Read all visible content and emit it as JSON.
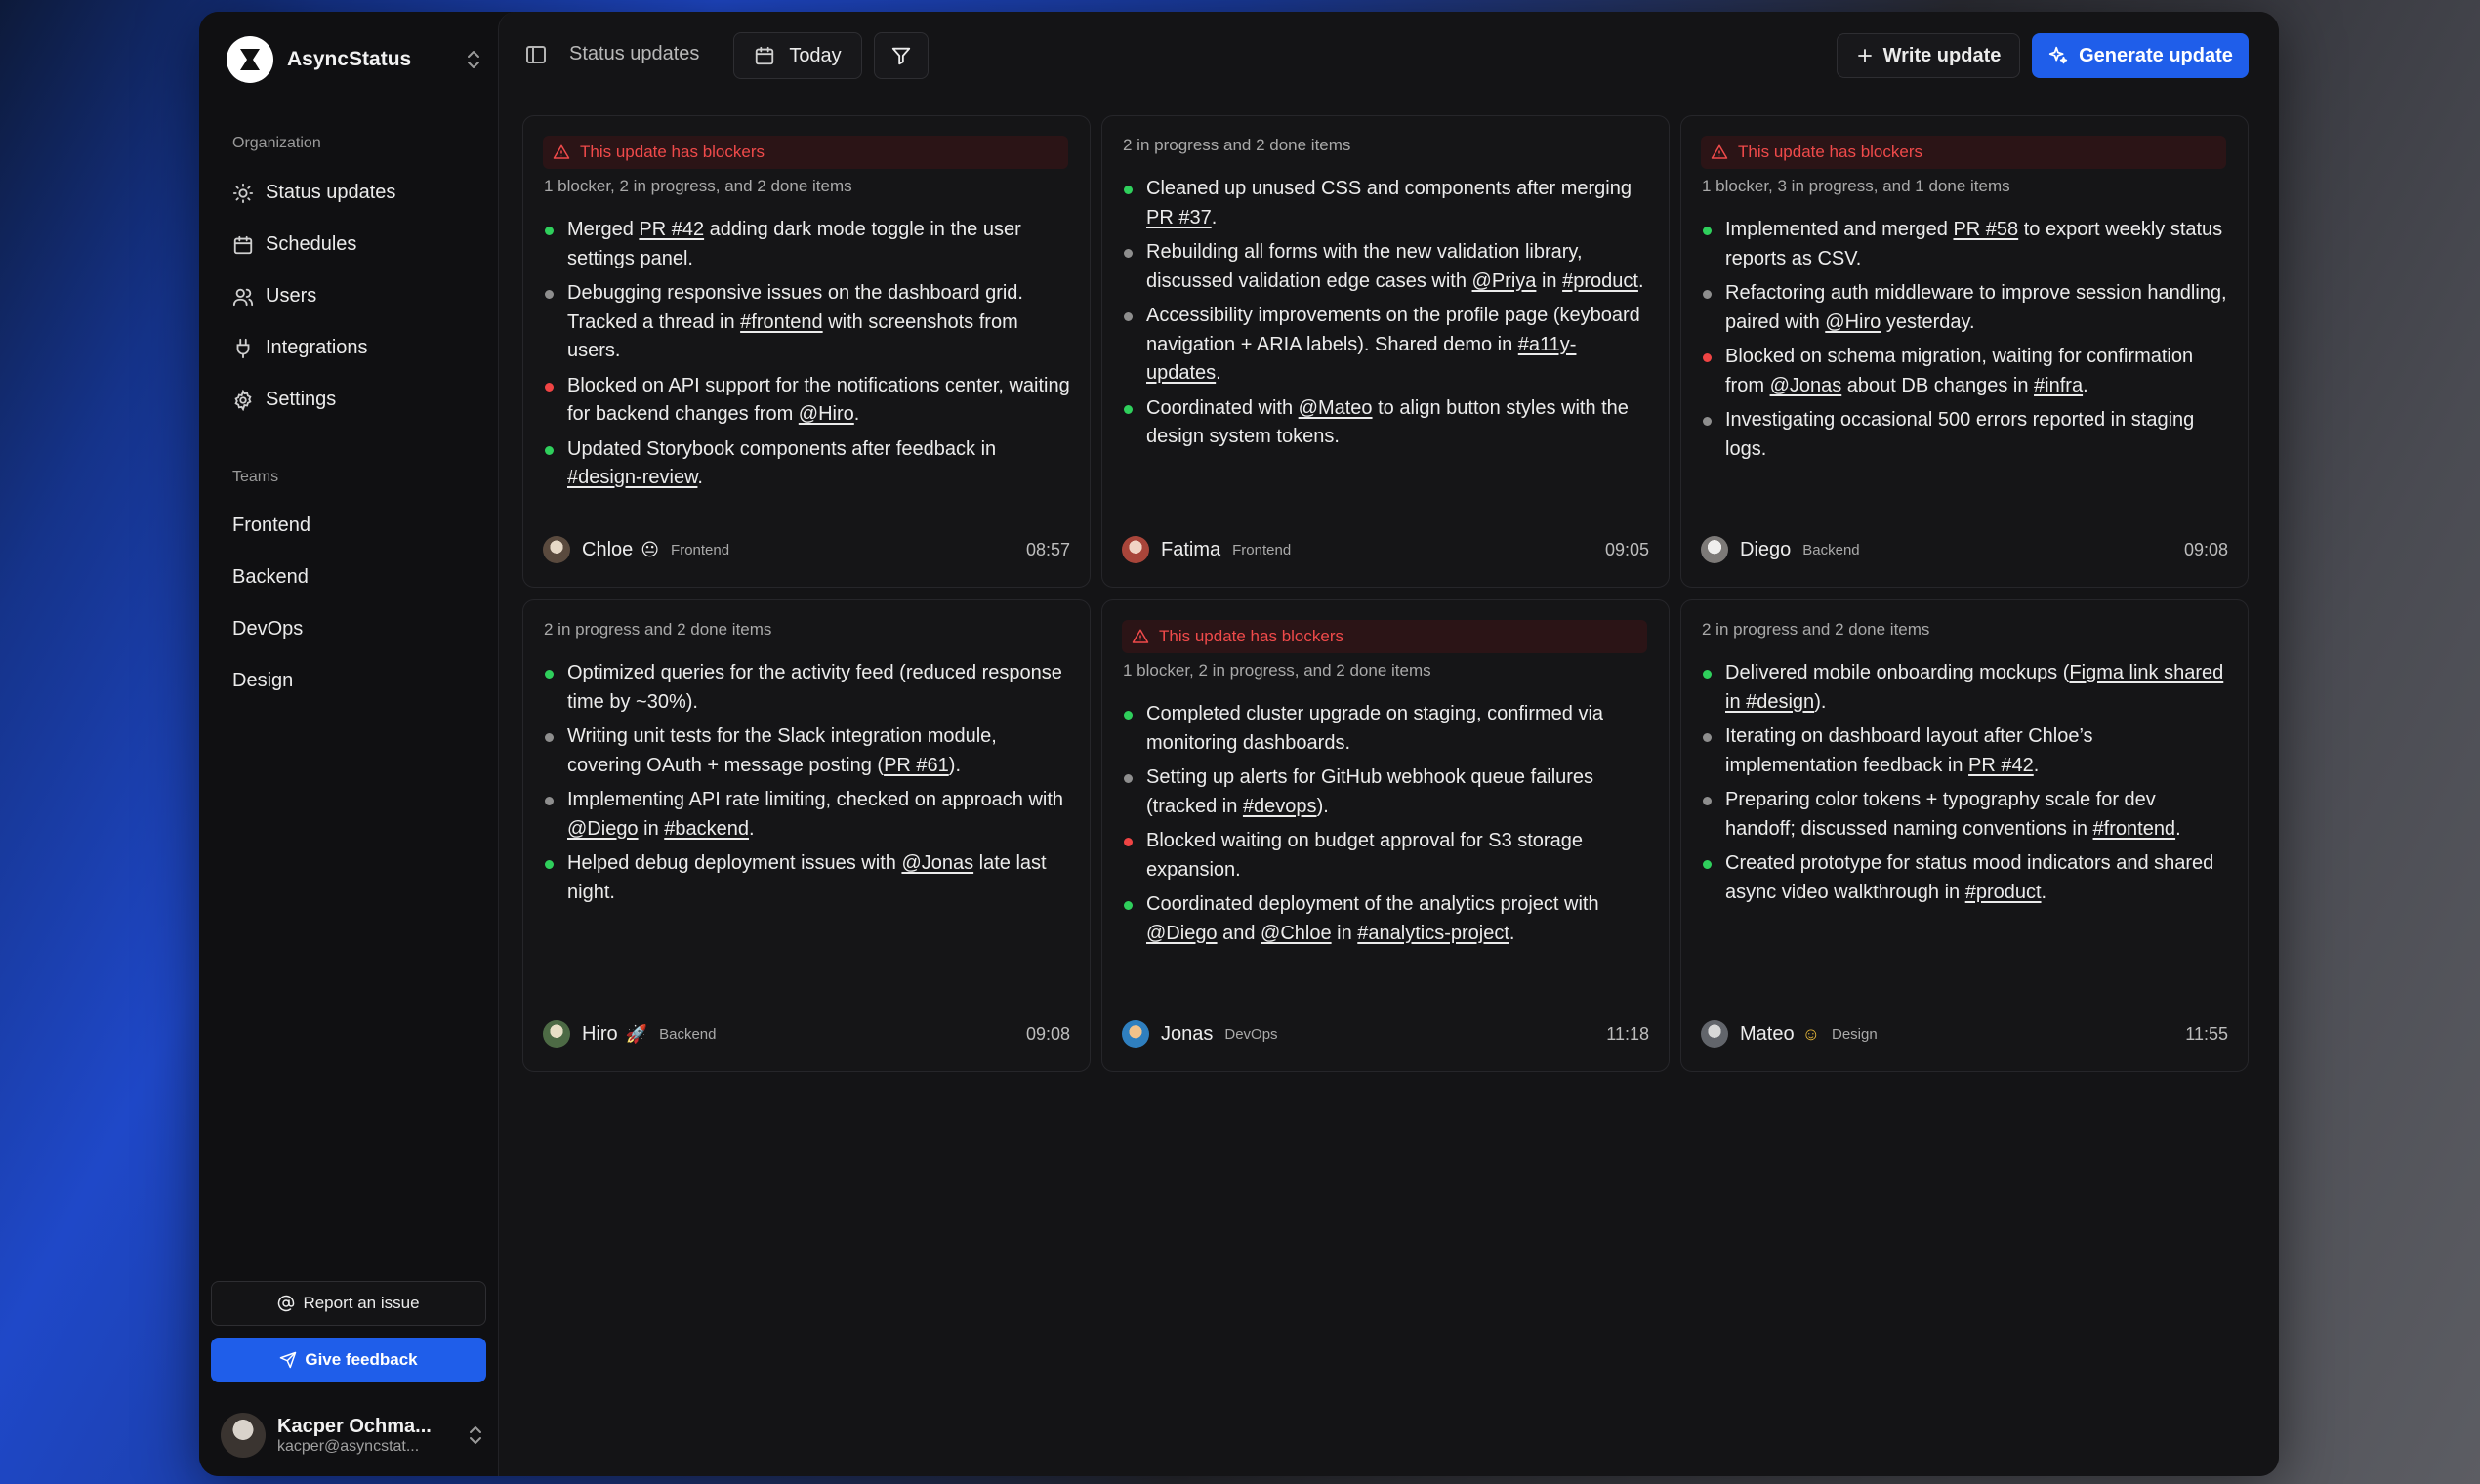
{
  "app": {
    "name": "AsyncStatus"
  },
  "sidebar": {
    "organization_label": "Organization",
    "nav": [
      {
        "label": "Status updates",
        "icon": "sun-icon"
      },
      {
        "label": "Schedules",
        "icon": "calendar-icon"
      },
      {
        "label": "Users",
        "icon": "users-icon"
      },
      {
        "label": "Integrations",
        "icon": "plug-icon"
      },
      {
        "label": "Settings",
        "icon": "gear-icon"
      }
    ],
    "teams_label": "Teams",
    "teams": [
      "Frontend",
      "Backend",
      "DevOps",
      "Design"
    ],
    "report_label": "Report an issue",
    "feedback_label": "Give feedback",
    "user": {
      "name": "Kacper Ochma...",
      "email": "kacper@asyncstat..."
    }
  },
  "toolbar": {
    "title": "Status updates",
    "date_label": "Today",
    "write_label": "Write update",
    "generate_label": "Generate update"
  },
  "colors": {
    "accent": "#1f5eea",
    "done": "#2fcf5c",
    "progress": "#8e8e8e",
    "blocker": "#ef4444"
  },
  "cards": [
    {
      "has_blocker": true,
      "blocker_text": "This update has blockers",
      "summary": "1 blocker, 2 in progress, and 2 done items",
      "items": [
        {
          "status": "done",
          "parts": [
            {
              "t": "Merged "
            },
            {
              "t": "PR #42",
              "ref": true
            },
            {
              "t": " adding dark mode toggle in the user settings panel."
            }
          ]
        },
        {
          "status": "progress",
          "parts": [
            {
              "t": "Debugging responsive issues on the dashboard grid. Tracked a thread in "
            },
            {
              "t": "#frontend",
              "ref": true
            },
            {
              "t": " with screenshots from users."
            }
          ]
        },
        {
          "status": "blocker",
          "parts": [
            {
              "t": "Blocked on API support for the notifications center, waiting for backend changes from "
            },
            {
              "t": "@Hiro",
              "ref": true
            },
            {
              "t": "."
            }
          ]
        },
        {
          "status": "done",
          "parts": [
            {
              "t": "Updated Storybook components after feedback in "
            },
            {
              "t": "#design-review",
              "ref": true
            },
            {
              "t": "."
            }
          ]
        }
      ],
      "author": "Chloe",
      "mood": "😐",
      "team": "Frontend",
      "time": "08:57"
    },
    {
      "has_blocker": false,
      "summary": "2 in progress and 2 done items",
      "items": [
        {
          "status": "done",
          "parts": [
            {
              "t": "Cleaned up unused CSS and components after merging "
            },
            {
              "t": "PR #37",
              "ref": true
            },
            {
              "t": "."
            }
          ]
        },
        {
          "status": "progress",
          "parts": [
            {
              "t": "Rebuilding all forms with the new validation library, discussed validation edge cases with "
            },
            {
              "t": "@Priya",
              "ref": true
            },
            {
              "t": " in "
            },
            {
              "t": "#product",
              "ref": true
            },
            {
              "t": "."
            }
          ]
        },
        {
          "status": "progress",
          "parts": [
            {
              "t": "Accessibility improvements on the profile page (keyboard navigation + ARIA labels). Shared demo in "
            },
            {
              "t": "#a11y-updates",
              "ref": true
            },
            {
              "t": "."
            }
          ]
        },
        {
          "status": "done",
          "parts": [
            {
              "t": "Coordinated with "
            },
            {
              "t": "@Mateo",
              "ref": true
            },
            {
              "t": " to align button styles with the design system tokens."
            }
          ]
        }
      ],
      "author": "Fatima",
      "mood": "",
      "team": "Frontend",
      "time": "09:05"
    },
    {
      "has_blocker": true,
      "blocker_text": "This update has blockers",
      "summary": "1 blocker, 3 in progress, and 1 done items",
      "items": [
        {
          "status": "done",
          "parts": [
            {
              "t": "Implemented and merged "
            },
            {
              "t": "PR #58",
              "ref": true
            },
            {
              "t": " to export weekly status reports as CSV."
            }
          ]
        },
        {
          "status": "progress",
          "parts": [
            {
              "t": "Refactoring auth middleware to improve session handling, paired with "
            },
            {
              "t": "@Hiro",
              "ref": true
            },
            {
              "t": " yesterday."
            }
          ]
        },
        {
          "status": "blocker",
          "parts": [
            {
              "t": "Blocked on schema migration, waiting for confirmation from "
            },
            {
              "t": "@Jonas",
              "ref": true
            },
            {
              "t": " about DB changes in "
            },
            {
              "t": "#infra",
              "ref": true
            },
            {
              "t": "."
            }
          ]
        },
        {
          "status": "progress",
          "parts": [
            {
              "t": "Investigating occasional 500 errors reported in staging logs."
            }
          ]
        }
      ],
      "author": "Diego",
      "mood": "",
      "team": "Backend",
      "time": "09:08"
    },
    {
      "has_blocker": false,
      "summary": "2 in progress and 2 done items",
      "items": [
        {
          "status": "done",
          "parts": [
            {
              "t": "Optimized queries for the activity feed (reduced response time by ~30%)."
            }
          ]
        },
        {
          "status": "progress",
          "parts": [
            {
              "t": "Writing unit tests for the Slack integration module, covering OAuth + message posting ("
            },
            {
              "t": "PR #61",
              "ref": true
            },
            {
              "t": ")."
            }
          ]
        },
        {
          "status": "progress",
          "parts": [
            {
              "t": "Implementing API rate limiting, checked on approach with "
            },
            {
              "t": "@Diego",
              "ref": true
            },
            {
              "t": " in "
            },
            {
              "t": "#backend",
              "ref": true
            },
            {
              "t": "."
            }
          ]
        },
        {
          "status": "done",
          "parts": [
            {
              "t": "Helped debug deployment issues with "
            },
            {
              "t": "@Jonas",
              "ref": true
            },
            {
              "t": " late last night."
            }
          ]
        }
      ],
      "author": "Hiro",
      "mood": "🚀",
      "team": "Backend",
      "time": "09:08"
    },
    {
      "has_blocker": true,
      "blocker_text": "This update has blockers",
      "summary": "1 blocker, 2 in progress, and 2 done items",
      "items": [
        {
          "status": "done",
          "parts": [
            {
              "t": "Completed cluster upgrade on staging, confirmed via monitoring dashboards."
            }
          ]
        },
        {
          "status": "progress",
          "parts": [
            {
              "t": "Setting up alerts for GitHub webhook queue failures (tracked in "
            },
            {
              "t": "#devops",
              "ref": true
            },
            {
              "t": ")."
            }
          ]
        },
        {
          "status": "blocker",
          "parts": [
            {
              "t": "Blocked waiting on budget approval for S3 storage expansion."
            }
          ]
        },
        {
          "status": "done",
          "parts": [
            {
              "t": "Coordinated deployment of the analytics project with "
            },
            {
              "t": "@Diego",
              "ref": true
            },
            {
              "t": " and "
            },
            {
              "t": "@Chloe",
              "ref": true
            },
            {
              "t": " in "
            },
            {
              "t": "#analytics-project",
              "ref": true
            },
            {
              "t": "."
            }
          ]
        }
      ],
      "author": "Jonas",
      "mood": "",
      "team": "DevOps",
      "time": "11:18"
    },
    {
      "has_blocker": false,
      "summary": "2 in progress and 2 done items",
      "items": [
        {
          "status": "done",
          "parts": [
            {
              "t": "Delivered mobile onboarding mockups ("
            },
            {
              "t": "Figma link shared in #design",
              "ref": true
            },
            {
              "t": ")."
            }
          ]
        },
        {
          "status": "progress",
          "parts": [
            {
              "t": "Iterating on dashboard layout after Chloe’s implementation feedback in "
            },
            {
              "t": "PR #42",
              "ref": true
            },
            {
              "t": "."
            }
          ]
        },
        {
          "status": "progress",
          "parts": [
            {
              "t": "Preparing color tokens + typography scale for dev handoff; discussed naming conventions in "
            },
            {
              "t": "#frontend",
              "ref": true
            },
            {
              "t": "."
            }
          ]
        },
        {
          "status": "done",
          "parts": [
            {
              "t": "Created prototype for status mood indicators and shared async video walkthrough in "
            },
            {
              "t": "#product",
              "ref": true
            },
            {
              "t": "."
            }
          ]
        }
      ],
      "author": "Mateo",
      "mood": "☺",
      "team": "Design",
      "time": "11:55"
    }
  ]
}
